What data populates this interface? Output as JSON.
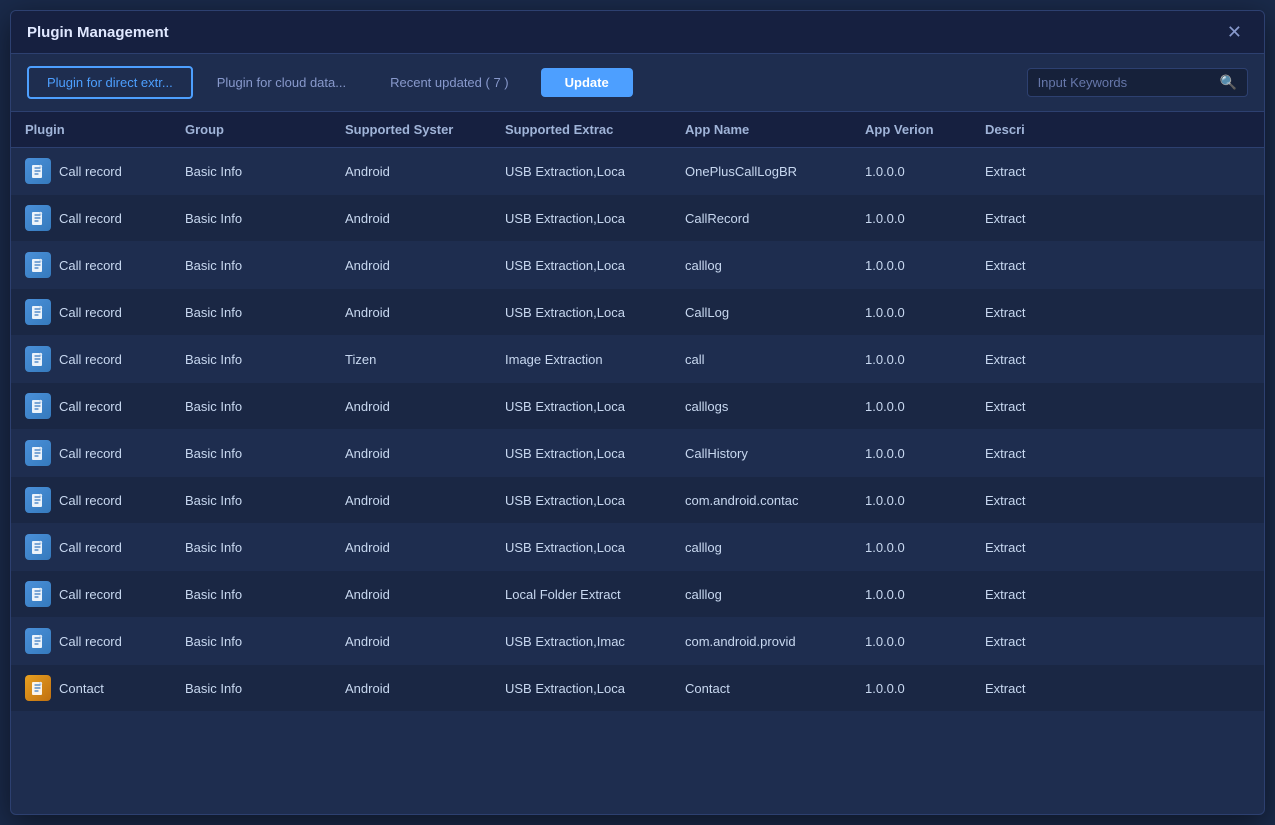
{
  "dialog": {
    "title": "Plugin Management",
    "close_label": "✕"
  },
  "toolbar": {
    "tabs": [
      {
        "id": "direct",
        "label": "Plugin for direct extr...",
        "active": true
      },
      {
        "id": "cloud",
        "label": "Plugin for cloud data...",
        "active": false
      },
      {
        "id": "recent",
        "label": "Recent updated ( 7 )",
        "active": false
      }
    ],
    "update_label": "Update",
    "search_placeholder": "Input Keywords"
  },
  "table": {
    "headers": [
      {
        "id": "plugin",
        "label": "Plugin"
      },
      {
        "id": "group",
        "label": "Group"
      },
      {
        "id": "system",
        "label": "Supported Syster"
      },
      {
        "id": "extract",
        "label": "Supported Extrac"
      },
      {
        "id": "appname",
        "label": "App Name"
      },
      {
        "id": "version",
        "label": "App Verion"
      },
      {
        "id": "desc",
        "label": "Descri"
      }
    ],
    "rows": [
      {
        "plugin": "Call record",
        "group": "Basic Info",
        "system": "Android",
        "extract": "USB Extraction,Loca",
        "appname": "OnePlusCallLogBR",
        "version": "1.0.0.0",
        "desc": "Extract",
        "icon": "blue"
      },
      {
        "plugin": "Call record",
        "group": "Basic Info",
        "system": "Android",
        "extract": "USB Extraction,Loca",
        "appname": "CallRecord",
        "version": "1.0.0.0",
        "desc": "Extract",
        "icon": "blue"
      },
      {
        "plugin": "Call record",
        "group": "Basic Info",
        "system": "Android",
        "extract": "USB Extraction,Loca",
        "appname": "calllog",
        "version": "1.0.0.0",
        "desc": "Extract",
        "icon": "blue"
      },
      {
        "plugin": "Call record",
        "group": "Basic Info",
        "system": "Android",
        "extract": "USB Extraction,Loca",
        "appname": "CallLog",
        "version": "1.0.0.0",
        "desc": "Extract",
        "icon": "blue"
      },
      {
        "plugin": "Call record",
        "group": "Basic Info",
        "system": "Tizen",
        "extract": "Image Extraction",
        "appname": "call",
        "version": "1.0.0.0",
        "desc": "Extract",
        "icon": "blue"
      },
      {
        "plugin": "Call record",
        "group": "Basic Info",
        "system": "Android",
        "extract": "USB Extraction,Loca",
        "appname": "calllogs",
        "version": "1.0.0.0",
        "desc": "Extract",
        "icon": "blue"
      },
      {
        "plugin": "Call record",
        "group": "Basic Info",
        "system": "Android",
        "extract": "USB Extraction,Loca",
        "appname": "CallHistory",
        "version": "1.0.0.0",
        "desc": "Extract",
        "icon": "blue"
      },
      {
        "plugin": "Call record",
        "group": "Basic Info",
        "system": "Android",
        "extract": "USB Extraction,Loca",
        "appname": "com.android.contac",
        "version": "1.0.0.0",
        "desc": "Extract",
        "icon": "blue"
      },
      {
        "plugin": "Call record",
        "group": "Basic Info",
        "system": "Android",
        "extract": "USB Extraction,Loca",
        "appname": "calllog",
        "version": "1.0.0.0",
        "desc": "Extract",
        "icon": "blue"
      },
      {
        "plugin": "Call record",
        "group": "Basic Info",
        "system": "Android",
        "extract": "Local Folder Extract",
        "appname": "calllog",
        "version": "1.0.0.0",
        "desc": "Extract",
        "icon": "blue"
      },
      {
        "plugin": "Call record",
        "group": "Basic Info",
        "system": "Android",
        "extract": "USB Extraction,Imac",
        "appname": "com.android.provid",
        "version": "1.0.0.0",
        "desc": "Extract",
        "icon": "blue"
      },
      {
        "plugin": "Contact",
        "group": "Basic Info",
        "system": "Android",
        "extract": "USB Extraction,Loca",
        "appname": "Contact",
        "version": "1.0.0.0",
        "desc": "Extract",
        "icon": "orange"
      }
    ]
  }
}
